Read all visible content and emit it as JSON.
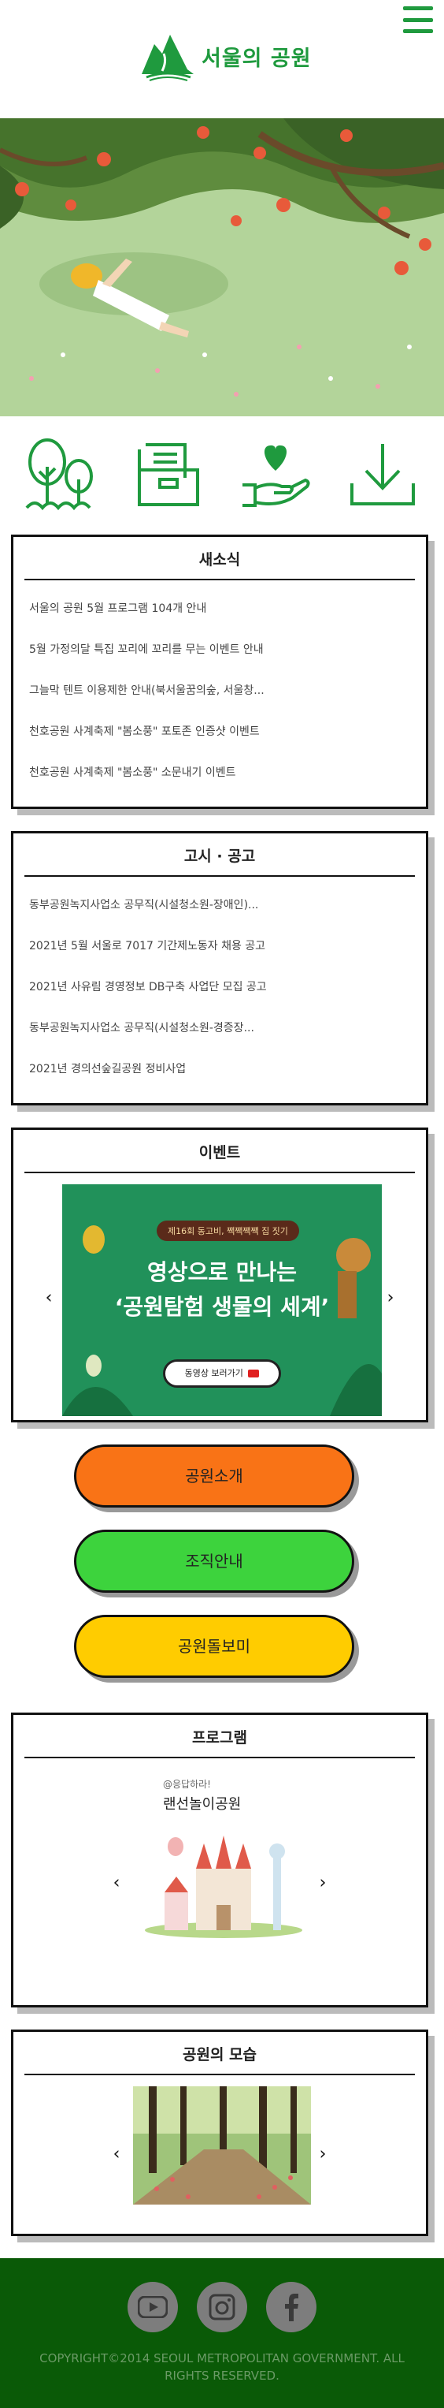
{
  "header": {
    "site_title": "서울의 공원"
  },
  "quick_icons": [
    "tree-icon",
    "folder-icon",
    "heart-hand-icon",
    "download-icon"
  ],
  "news": {
    "title": "새소식",
    "items": [
      "서울의 공원 5월 프로그램 104개 안내",
      "5월 가정의달 특집 꼬리에 꼬리를 무는 이벤트 안내",
      "그늘막 텐트 이용제한 안내(북서울꿈의숲, 서울창...",
      "천호공원 사계축제 \"봄소풍\" 포토존 인증샷 이벤트",
      "천호공원 사계축제 \"봄소풍\" 소문내기 이벤트"
    ]
  },
  "notice": {
    "title": "고시 · 공고",
    "items": [
      "동부공원녹지사업소 공무직(시설청소원-장애인)...",
      "2021년 5월 서울로 7017 기간제노동자 채용 공고",
      "2021년 사유림 경영정보 DB구축 사업단 모집 공고",
      "동부공원녹지사업소 공무직(시설청소원-경증장...",
      "2021년 경의선숲길공원 정비사업"
    ]
  },
  "event": {
    "title": "이벤트",
    "banner_badge": "제16회 동고비, 짹짹짹짹 집 짓기",
    "banner_line1": "영상으로 만나는",
    "banner_line2": "‘공원탐험 생물의 세계’",
    "banner_button": "동영상 보러가기",
    "prev": "‹",
    "next": "›"
  },
  "buttons": [
    {
      "label": "공원소개",
      "color": "#f97316"
    },
    {
      "label": "조직안내",
      "color": "#3dd33d"
    },
    {
      "label": "공원돌보미",
      "color": "#ffcc00"
    }
  ],
  "program": {
    "title": "프로그램",
    "caption_small": "@응답하라!",
    "caption": "랜선놀이공원",
    "prev": "‹",
    "next": "›"
  },
  "gallery": {
    "title": "공원의 모습",
    "prev": "‹",
    "next": "›"
  },
  "footer": {
    "sns": [
      "youtube-icon",
      "instagram-icon",
      "facebook-icon"
    ],
    "copyright": "COPYRIGHT©2014 SEOUL METROPOLITAN GOVERNMENT. ALL RIGHTS RESERVED."
  }
}
